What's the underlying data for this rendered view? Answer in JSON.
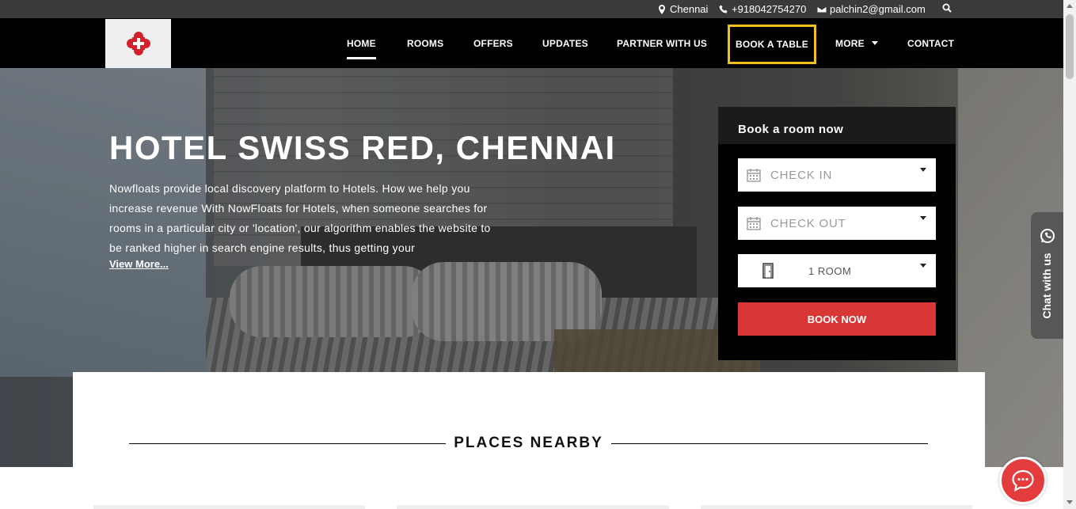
{
  "topbar": {
    "location": "Chennai",
    "phone": "+918042754270",
    "email": "palchin2@gmail.com"
  },
  "nav": {
    "items": [
      {
        "label": "HOME"
      },
      {
        "label": "ROOMS"
      },
      {
        "label": "OFFERS"
      },
      {
        "label": "UPDATES"
      },
      {
        "label": "PARTNER WITH US"
      },
      {
        "label": "BOOK A TABLE"
      },
      {
        "label": "MORE"
      },
      {
        "label": "CONTACT"
      }
    ]
  },
  "hero": {
    "title": "HOTEL SWISS RED, CHENNAI",
    "description": "Nowfloats provide local discovery platform to Hotels. How we help you increase revenue With NowFloats for Hotels, when someone searches for rooms in a particular city or 'location', our algorithm enables the website to be ranked higher in search engine results, thus getting your",
    "view_more": "View More..."
  },
  "booking": {
    "heading": "Book a room now",
    "checkin_placeholder": "CHECK IN",
    "checkout_placeholder": "CHECK OUT",
    "rooms_value": "1 ROOM",
    "book_button": "BOOK NOW"
  },
  "chat": {
    "label": "Chat with us"
  },
  "section": {
    "places_title": "PLACES NEARBY"
  },
  "colors": {
    "accent": "#d93636",
    "highlight_border": "#f2c01b",
    "nav_bg": "#000000",
    "topbar_bg": "#3a3a3a"
  }
}
